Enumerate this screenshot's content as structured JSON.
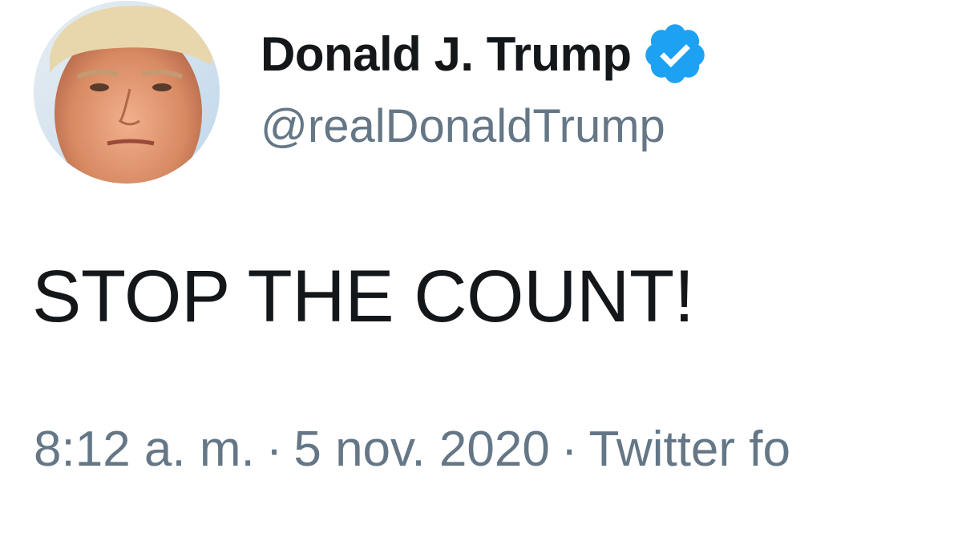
{
  "author": {
    "display_name": "Donald J. Trump",
    "handle": "@realDonaldTrump",
    "verified": true,
    "avatar_icon": "profile-photo",
    "verified_icon": "verified-badge-icon"
  },
  "tweet": {
    "text": "STOP THE COUNT!",
    "time": "8:12 a. m.",
    "date": "5 nov. 2020",
    "source": "Twitter fo",
    "separator": "·"
  },
  "colors": {
    "text_primary": "#14171a",
    "text_secondary": "#657786",
    "verified_blue": "#1da1f2",
    "background": "#ffffff"
  }
}
